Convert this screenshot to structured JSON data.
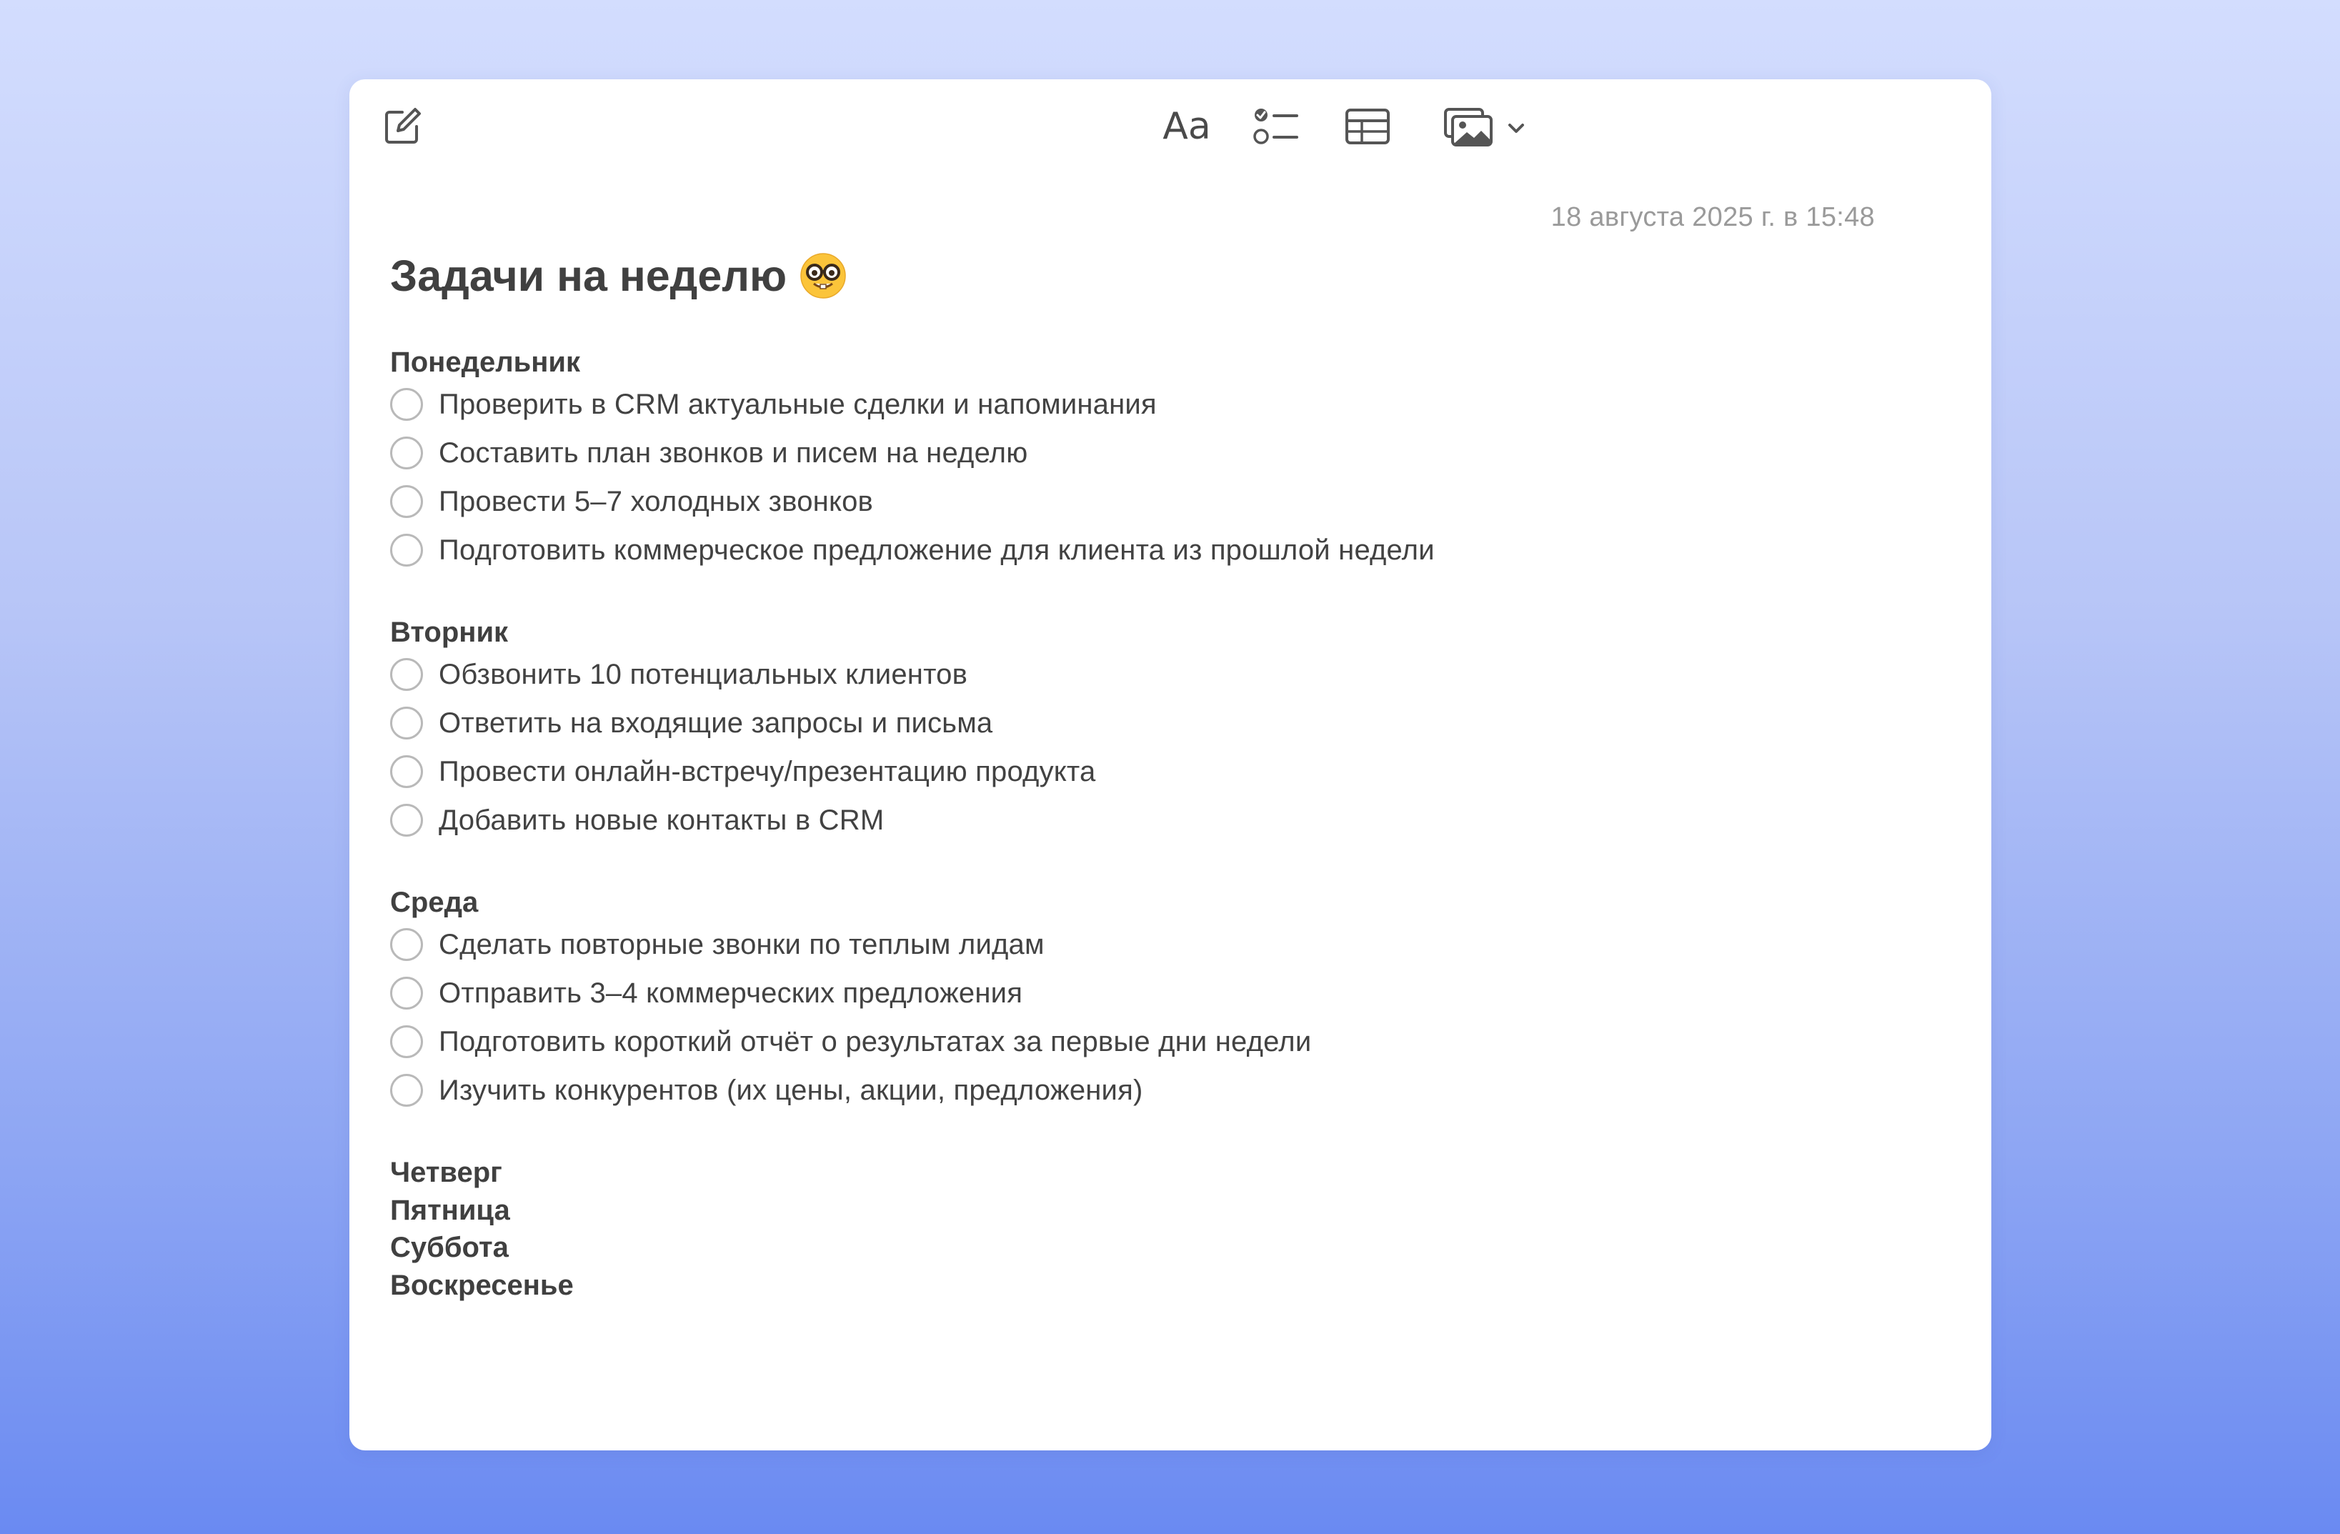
{
  "note": {
    "timestamp": "18 августа 2025 г. в 15:48",
    "title": "Задачи на неделю",
    "title_emoji": "nerd-face-emoji"
  },
  "toolbar": {
    "compose_icon": "compose-icon",
    "format_label": "Aa",
    "checklist_icon": "checklist-icon",
    "table_icon": "table-icon",
    "media_icon": "media-icon",
    "media_dropdown_icon": "chevron-down-icon"
  },
  "days": [
    {
      "name": "Понедельник",
      "tasks": [
        "Проверить в CRM актуальные сделки и напоминания",
        "Составить план звонков и писем на неделю",
        "Провести 5–7 холодных звонков",
        "Подготовить коммерческое предложение для клиента из прошлой недели"
      ]
    },
    {
      "name": "Вторник",
      "tasks": [
        "Обзвонить 10 потенциальных клиентов",
        "Ответить на входящие запросы и письма",
        "Провести онлайн-встречу/презентацию продукта",
        "Добавить новые контакты в CRM"
      ]
    },
    {
      "name": "Среда",
      "tasks": [
        "Сделать повторные звонки по теплым лидам",
        "Отправить 3–4 коммерческих предложения",
        "Подготовить короткий отчёт о результатах за первые дни недели",
        "Изучить конкурентов (их цены, акции, предложения)"
      ]
    },
    {
      "name": "Четверг",
      "tasks": []
    },
    {
      "name": "Пятница",
      "tasks": []
    },
    {
      "name": "Суббота",
      "tasks": []
    },
    {
      "name": "Воскресенье",
      "tasks": []
    }
  ],
  "colors": {
    "background_top": "#d3ddfe",
    "background_bottom": "#6a8af2",
    "window": "#ffffff",
    "text": "#404040",
    "timestamp": "#9a9a9a",
    "checkbox": "#b9b9b9"
  }
}
